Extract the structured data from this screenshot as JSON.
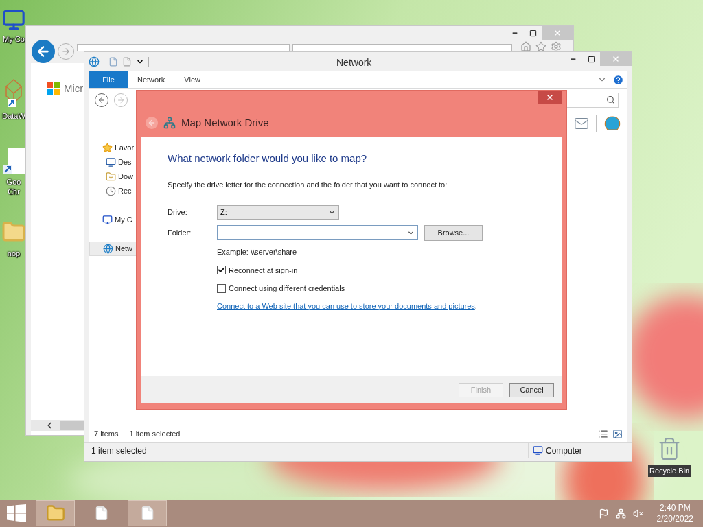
{
  "desktop_icons": [
    {
      "kind": "computer",
      "lines": [
        "My Co"
      ]
    },
    {
      "kind": "app",
      "lines": [
        "DataW"
      ]
    },
    {
      "kind": "shortcut",
      "lines": [
        "Goo",
        "Chr"
      ]
    },
    {
      "kind": "folder",
      "lines": [
        "nop"
      ]
    }
  ],
  "recycle_bin": {
    "label": "Recycle Bin"
  },
  "browser": {
    "page_text": "Micr"
  },
  "explorer": {
    "title": "Network",
    "ribbon_tabs": [
      {
        "label": "File",
        "selected": true
      },
      {
        "label": "Network",
        "selected": false
      },
      {
        "label": "View",
        "selected": false
      }
    ],
    "nav_items": [
      {
        "kind": "favorites",
        "label": "Favor",
        "selected": false
      },
      {
        "kind": "desktop",
        "label": "Des",
        "selected": false
      },
      {
        "kind": "downloads",
        "label": "Dow",
        "selected": false
      },
      {
        "kind": "recent",
        "label": "Rec",
        "selected": false
      },
      {
        "kind": "computer",
        "label": "My C",
        "selected": false
      },
      {
        "kind": "network",
        "label": "Netw",
        "selected": true
      }
    ],
    "item_count": "7 items",
    "selection": "1 item selected",
    "status_left": "1 item selected",
    "status_right": "Computer"
  },
  "dialog": {
    "title": "Map Network Drive",
    "heading": "What network folder would you like to map?",
    "instruction": "Specify the drive letter for the connection and the folder that you want to connect to:",
    "drive": {
      "label": "Drive:",
      "value": "Z:"
    },
    "folder": {
      "label": "Folder:"
    },
    "browse_button": "Browse...",
    "example": "Example: \\\\server\\share",
    "options": [
      {
        "label": "Reconnect at sign-in",
        "checked": true
      },
      {
        "label": "Connect using different credentials",
        "checked": false
      }
    ],
    "link": {
      "text": "Connect to a Web site that you can use to store your documents and pictures",
      "suffix": "."
    },
    "buttons": [
      {
        "label": "Finish",
        "disabled": true
      },
      {
        "label": "Cancel",
        "disabled": false
      }
    ]
  },
  "taskbar": {
    "apps": [
      {
        "kind": "explorer",
        "active": true
      },
      {
        "kind": "document",
        "active": false
      },
      {
        "kind": "document",
        "active": true
      }
    ],
    "clock": {
      "time": "2:40 PM",
      "date": "2/20/2022"
    }
  }
}
